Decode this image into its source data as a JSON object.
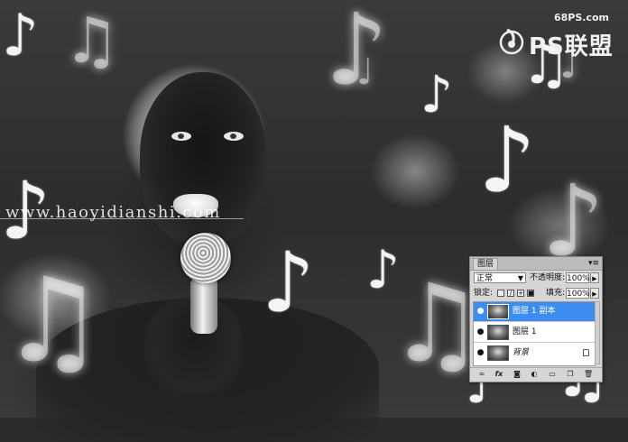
{
  "canvas": {
    "watermark_text": "www.haoyidianshi.com",
    "notes": [
      "♪",
      "♫",
      "♩",
      "♬"
    ]
  },
  "logo": {
    "site": "68PS.com",
    "text": "PS联盟"
  },
  "layers_panel": {
    "tab_label": "图层",
    "menu_icon": "panel-menu-icon",
    "blend_mode": "正常",
    "opacity_label": "不透明度:",
    "opacity_value": "100%",
    "lock_label": "锁定:",
    "fill_label": "填充:",
    "fill_value": "100%",
    "layers": [
      {
        "name": "图层 1 副本",
        "selected": true,
        "visible": true
      },
      {
        "name": "图层 1",
        "selected": false,
        "visible": true
      },
      {
        "name": "背景",
        "selected": false,
        "visible": true,
        "locked": true
      }
    ],
    "bottom_icons": [
      "link-icon",
      "fx-icon",
      "mask-icon",
      "adjustment-icon",
      "folder-icon",
      "new-layer-icon",
      "trash-icon"
    ]
  },
  "colors": {
    "selected_layer": "#3d8cf0",
    "panel_bg": "#d6d6d6"
  }
}
